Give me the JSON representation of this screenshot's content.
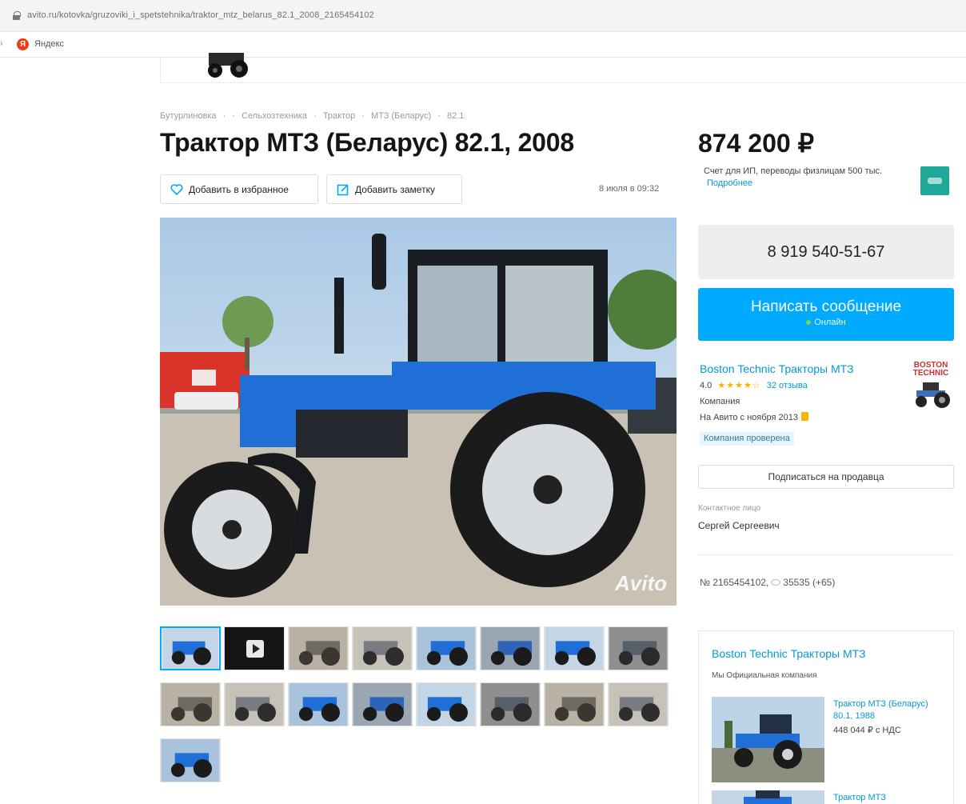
{
  "browser": {
    "url": "avito.ru/kotovka/gruzoviki_i_spetstehnika/traktor_mtz_belarus_82.1_2008_2165454102",
    "bookmark_label": "Яндекс",
    "bookmark_letter": "Я"
  },
  "breadcrumb": [
    "Бутурлиновка",
    "·",
    "·",
    "Сельхозтехника",
    "·",
    "Трактор",
    "·",
    "МТЗ (Беларус)",
    "·",
    "82.1"
  ],
  "listing": {
    "title": "Трактор МТЗ (Беларус) 82.1, 2008",
    "add_favorite_label": "Добавить в избранное",
    "add_note_label": "Добавить заметку",
    "published": "8 июля в 09:32",
    "watermark": "Avito",
    "photo_count": 17,
    "active_photo": 1,
    "video_thumb_index": 2
  },
  "sidebar": {
    "price": "874 200 ₽",
    "payment_note": "Счет для ИП, переводы физлицам 500 тыс.",
    "payment_more": "Подробнее",
    "phone": "8 919 540-51-67",
    "message_button": "Написать сообщение",
    "message_status": "Онлайн",
    "seller": {
      "name": "Boston Technic Тракторы МТЗ",
      "rating": "4.0",
      "stars": "★★★★☆",
      "reviews": "32 отзыва",
      "type": "Компания",
      "since": "На Авито с ноября 2013",
      "verified": "Компания проверена",
      "logo_text_1": "BOSTON",
      "logo_text_2": "TECHNIC"
    },
    "subscribe_button": "Подписаться на продавца",
    "contact_label": "Контактное лицо",
    "contact_name": "Сергей Сергеевич",
    "ad_number": "№ 2165454102,",
    "views": "35535 (+65)"
  },
  "shop_box": {
    "title": "Boston Technic Тракторы МТЗ",
    "subtitle": "Мы Официальная компания",
    "ads": [
      {
        "title": "Трактор МТЗ (Беларус) 80.1, 1988",
        "price": "448 044 ₽ с НДС"
      },
      {
        "title": "Трактор МТЗ"
      }
    ]
  },
  "colors": {
    "accent": "#00aaff",
    "link": "#0099dd",
    "tractor_blue": "#1f6fd6",
    "phone_bg": "#eeeeee"
  }
}
